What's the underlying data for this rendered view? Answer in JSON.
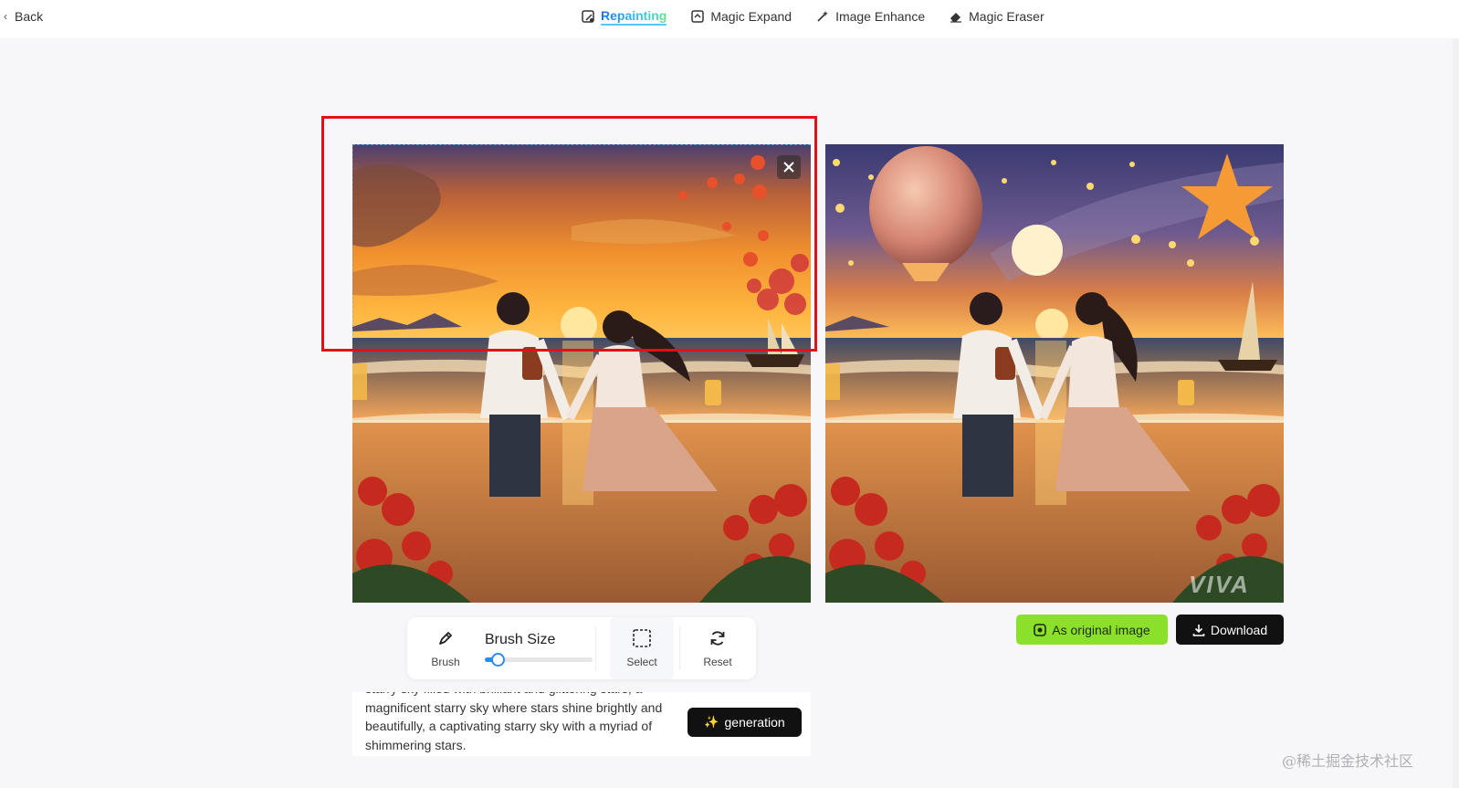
{
  "header": {
    "back_label": "Back",
    "tabs": [
      {
        "label": "Repainting",
        "icon": "repaint-icon",
        "active": true
      },
      {
        "label": "Magic Expand",
        "icon": "expand-icon",
        "active": false
      },
      {
        "label": "Image Enhance",
        "icon": "enhance-icon",
        "active": false
      },
      {
        "label": "Magic Eraser",
        "icon": "eraser-icon",
        "active": false
      }
    ]
  },
  "editor": {
    "close_icon": "close-icon",
    "watermark": "VIVA"
  },
  "toolbar": {
    "brush_label": "Brush",
    "brush_size_label": "Brush Size",
    "brush_size_value": 0.12,
    "select_label": "Select",
    "reset_label": "Reset"
  },
  "prompt": {
    "text": "starry sky filled with brilliant and glittering stars, a magnificent starry sky where stars shine brightly and beautifully, a captivating starry sky with a myriad of shimmering stars.",
    "generate_label": "generation"
  },
  "result_actions": {
    "as_original_label": "As original image",
    "download_label": "Download"
  },
  "footer": {
    "site_mark": "@稀土掘金技术社区"
  },
  "colors": {
    "highlight_box": "#e3101a",
    "as_original_bg": "#8be02a",
    "dark_button_bg": "#111111",
    "slider_accent": "#2a8cf0"
  }
}
